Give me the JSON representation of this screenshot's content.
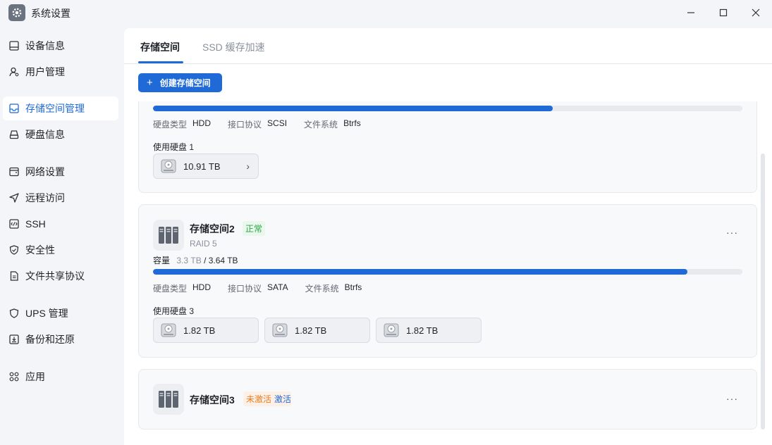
{
  "window": {
    "title": "系统设置",
    "icon": "gear-icon",
    "controls": [
      "minimize-icon",
      "maximize-icon",
      "close-icon"
    ]
  },
  "sidebar": {
    "items": [
      {
        "label": "设备信息",
        "icon": "device-icon"
      },
      {
        "label": "用户管理",
        "icon": "user-icon"
      },
      {
        "label": "存储空间管理",
        "icon": "storage-icon",
        "active": true
      },
      {
        "label": "硬盘信息",
        "icon": "disk-icon"
      },
      {
        "label": "网络设置",
        "icon": "network-icon"
      },
      {
        "label": "远程访问",
        "icon": "send-icon"
      },
      {
        "label": "SSH",
        "icon": "code-icon"
      },
      {
        "label": "安全性",
        "icon": "shield-icon"
      },
      {
        "label": "文件共享协议",
        "icon": "file-icon"
      },
      {
        "label": "UPS 管理",
        "icon": "ups-shield-icon"
      },
      {
        "label": "备份和还原",
        "icon": "backup-icon"
      },
      {
        "label": "应用",
        "icon": "apps-icon"
      }
    ]
  },
  "tabs": [
    {
      "label": "存储空间",
      "active": true
    },
    {
      "label": "SSD 缓存加速",
      "active": false
    }
  ],
  "toolbar": {
    "create_label": "创建存储空间",
    "create_icon": "plus-icon"
  },
  "pools": [
    {
      "usage_fraction": 0.678,
      "meta": [
        {
          "key": "硬盘类型",
          "value": "HDD"
        },
        {
          "key": "接口协议",
          "value": "SCSI"
        },
        {
          "key": "文件系统",
          "value": "Btrfs"
        }
      ],
      "used_disks_label": "使用硬盘 1",
      "disks": [
        "10.91 TB"
      ]
    },
    {
      "name": "存储空间2",
      "status": "正常",
      "raid": "RAID 5",
      "capacity_label": "容量",
      "capacity_used": "3.3 TB",
      "capacity_total": "/ 3.64 TB",
      "usage_fraction": 0.907,
      "meta": [
        {
          "key": "硬盘类型",
          "value": "HDD"
        },
        {
          "key": "接口协议",
          "value": "SATA"
        },
        {
          "key": "文件系统",
          "value": "Btrfs"
        }
      ],
      "used_disks_label": "使用硬盘 3",
      "disks": [
        "1.82 TB",
        "1.82 TB",
        "1.82 TB"
      ],
      "more": "···"
    },
    {
      "name": "存储空间3",
      "status": "未激活",
      "action": "激活",
      "more": "···"
    }
  ],
  "colors": {
    "accent": "#1f6ad6",
    "ok": "#28a745",
    "warn": "#e67e22"
  }
}
